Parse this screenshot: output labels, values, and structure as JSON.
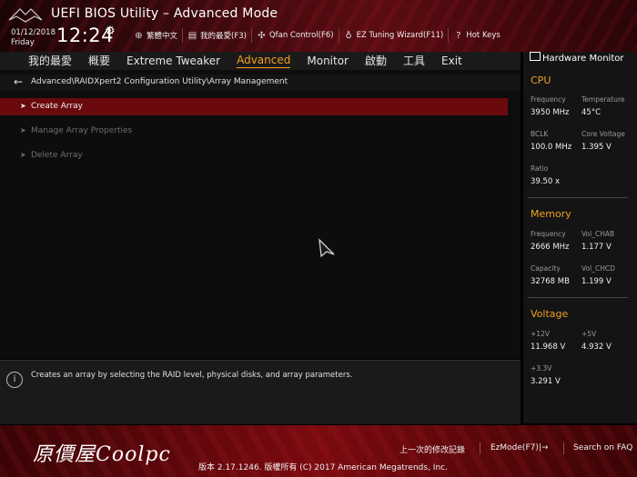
{
  "header": {
    "title": "UEFI BIOS Utility – Advanced Mode",
    "date": "01/12/2018",
    "day": "Friday",
    "time": "12:24",
    "toolbar": [
      {
        "label": "繁體中文",
        "icon": "globe-icon"
      },
      {
        "label": "我的最愛(F3)",
        "icon": "favorites-icon"
      },
      {
        "label": "Qfan Control(F6)",
        "icon": "fan-icon"
      },
      {
        "label": "EZ Tuning Wizard(F11)",
        "icon": "bulb-icon"
      },
      {
        "label": "Hot Keys",
        "icon": "question-icon"
      }
    ]
  },
  "tabs": [
    {
      "label": "我的最愛",
      "active": false
    },
    {
      "label": "概要",
      "active": false
    },
    {
      "label": "Extreme Tweaker",
      "active": false
    },
    {
      "label": "Advanced",
      "active": true
    },
    {
      "label": "Monitor",
      "active": false
    },
    {
      "label": "啟動",
      "active": false
    },
    {
      "label": "工具",
      "active": false
    },
    {
      "label": "Exit",
      "active": false
    }
  ],
  "breadcrumb": "Advanced\\RAIDXpert2 Configuration Utility\\Array Management",
  "menu": [
    {
      "label": "Create Array",
      "state": "selected"
    },
    {
      "label": "Manage Array Properties",
      "state": "disabled"
    },
    {
      "label": "Delete Array",
      "state": "disabled"
    }
  ],
  "help_text": "Creates an array by selecting the RAID level, physical disks, and array parameters.",
  "hw_monitor": {
    "title": "Hardware Monitor",
    "cpu": {
      "heading": "CPU",
      "frequency_label": "Frequency",
      "frequency": "3950 MHz",
      "temperature_label": "Temperature",
      "temperature": "45°C",
      "bclk_label": "BCLK",
      "bclk": "100.0 MHz",
      "core_voltage_label": "Core Voltage",
      "core_voltage": "1.395 V",
      "ratio_label": "Ratio",
      "ratio": "39.50 x"
    },
    "memory": {
      "heading": "Memory",
      "frequency_label": "Frequency",
      "frequency": "2666 MHz",
      "vol_chab_label": "Vol_CHAB",
      "vol_chab": "1.177 V",
      "capacity_label": "Capacity",
      "capacity": "32768 MB",
      "vol_chcd_label": "Vol_CHCD",
      "vol_chcd": "1.199 V"
    },
    "voltage": {
      "heading": "Voltage",
      "v12_label": "+12V",
      "v12": "11.968 V",
      "v5_label": "+5V",
      "v5": "4.932 V",
      "v33_label": "+3.3V",
      "v33": "3.291 V"
    }
  },
  "footer": {
    "watermark": "原價屋Coolpc",
    "last_modified": "上一次的修改記錄",
    "ezmode": "EzMode(F7)|→",
    "search": "Search on FAQ",
    "version": "版本 2.17.1246. 版權所有 (C) 2017 American Megatrends, Inc."
  },
  "colors": {
    "accent": "#f0a020",
    "selected_row": "#6a0a0e"
  }
}
